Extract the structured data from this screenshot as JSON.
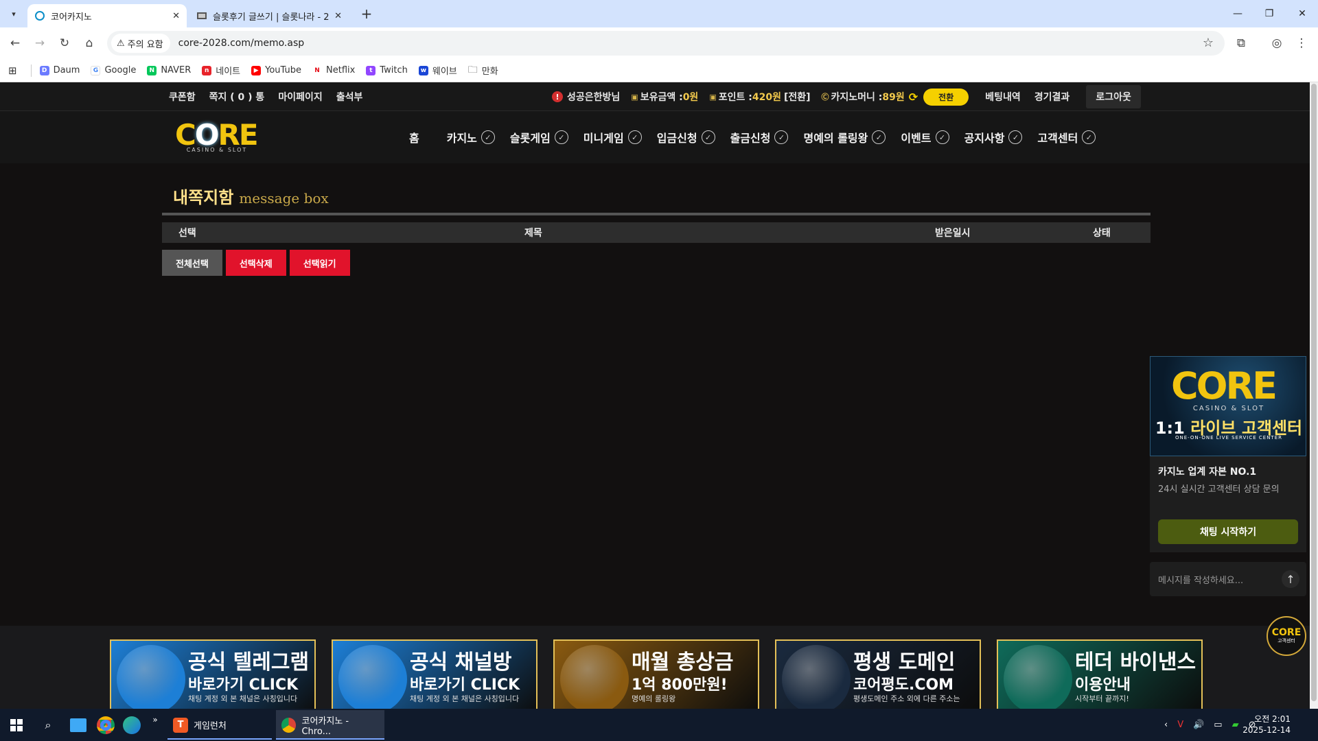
{
  "browser": {
    "tabs": [
      {
        "title": "코어카지노",
        "active": true
      },
      {
        "title": "슬롯후기 글쓰기 | 슬롯나라 - 2",
        "active": false
      }
    ],
    "address": {
      "security_label": "주의 요함",
      "url": "core-2028.com/memo.asp"
    },
    "bookmarks": [
      "Daum",
      "Google",
      "NAVER",
      "네이트",
      "YouTube",
      "Netflix",
      "Twitch",
      "웨이브",
      "만화"
    ]
  },
  "site": {
    "topbar": {
      "left_links": [
        "쿠폰함",
        "쪽지 ( 0 ) 통",
        "마이페이지",
        "출석부"
      ],
      "user_name": "성공은한방님",
      "balance_label": "보유금액 : ",
      "balance_value": "0원",
      "point_label": "포인트 : ",
      "point_value": "420원",
      "point_convert": "[전환]",
      "casino_money_label": "카지노머니 : ",
      "casino_money_value": "89원",
      "convert_button": "전환",
      "right_links": [
        "베팅내역",
        "경기결과"
      ],
      "logout": "로그아웃"
    },
    "logo": {
      "text": "CORE",
      "subtitle": "CASINO & SLOT"
    },
    "menu": [
      "홈",
      "카지노",
      "슬롯게임",
      "미니게임",
      "입금신청",
      "출금신청",
      "명예의 롤링왕",
      "이벤트",
      "공지사항",
      "고객센터"
    ],
    "page": {
      "title_ko": "내쪽지함",
      "title_en": "message box",
      "columns": [
        "선택",
        "제목",
        "받은일시",
        "상태"
      ],
      "actions": [
        "전체선택",
        "선택삭제",
        "선택읽기"
      ]
    },
    "banners": [
      {
        "line1": "공식 텔레그램",
        "line2": "바로가기 CLICK",
        "line3": "채팅 계정 외 본 채널은 사칭입니다",
        "color": "#1d7fd6"
      },
      {
        "line1": "공식 채널방",
        "line2": "바로가기 CLICK",
        "line3": "채팅 계정 외 본 채널은 사칭입니다",
        "color": "#1d7fd6"
      },
      {
        "line1": "매월 총상금",
        "line2": "1억 800만원!",
        "line3": "명예의 롤링왕",
        "color": "#8a5a10"
      },
      {
        "line1": "평생 도메인",
        "line2": "코어평도.COM",
        "line3": "평생도메인 주소 외에 다른 주소는",
        "color": "#1a2a3f"
      },
      {
        "line1": "테더 바이낸스",
        "line2": "이용안내",
        "line3": "시작부터 끝까지!",
        "color": "#0f6b5a"
      }
    ],
    "chat_widget": {
      "logo": "CORE",
      "logo_sub": "CASINO & SLOT",
      "live_prefix": "1:1",
      "live_title": "라이브 고객센터",
      "live_eng": "ONE-ON-ONE LIVE SERVICE CENTER",
      "headline": "카지노 업계 자본 NO.1",
      "description": "24시 실시간 고객센터 상담 문의",
      "start_button": "채팅 시작하기",
      "message_placeholder": "메시지를 작성하세요..."
    },
    "float_logo": {
      "text": "CORE",
      "sub": "고객센터"
    }
  },
  "taskbar": {
    "apps": [
      "게임런처",
      "코어카지노 - Chro..."
    ],
    "time": "오전 2:01",
    "date": "2025-12-14"
  },
  "colors": {
    "accent_gold": "#f1c40f",
    "danger_red": "#e1132b",
    "chat_green": "#4c5c10",
    "convert_yellow": "#f5d000"
  }
}
